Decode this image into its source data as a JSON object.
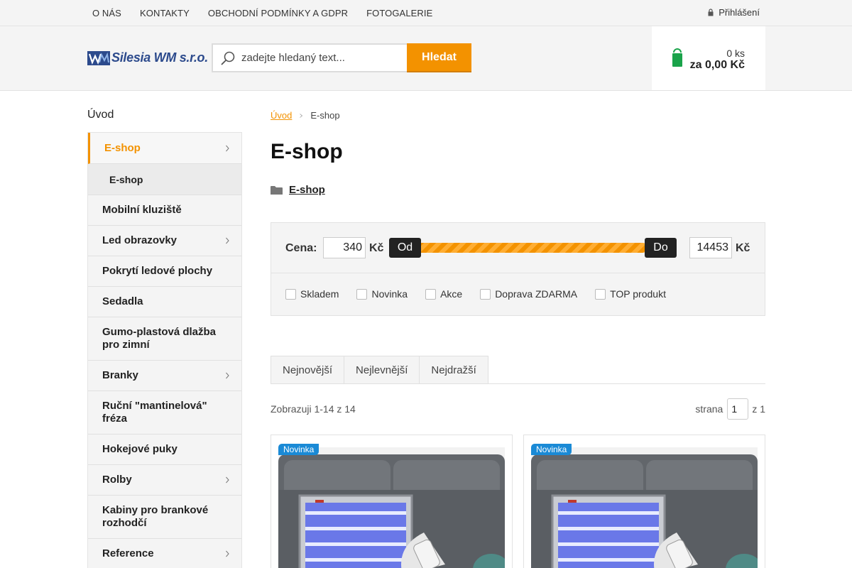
{
  "topnav": {
    "links": [
      "O NÁS",
      "KONTAKTY",
      "OBCHODNÍ PODMÍNKY A GDPR",
      "FOTOGALERIE"
    ],
    "login": "Přihlášení"
  },
  "header": {
    "logo_text": "Silesia WM s.r.o.",
    "search_placeholder": "zadejte hledaný text...",
    "search_button": "Hledat",
    "cart_qty": "0 ks",
    "cart_price": "za 0,00 Kč"
  },
  "sidebar": {
    "title": "Úvod",
    "items": [
      {
        "label": "E-shop",
        "active": true,
        "chevron": true
      },
      {
        "label": "E-shop",
        "sub": true
      },
      {
        "label": "Mobilní kluziště"
      },
      {
        "label": "Led obrazovky",
        "chevron": true
      },
      {
        "label": "Pokrytí ledové plochy"
      },
      {
        "label": "Sedadla"
      },
      {
        "label": "Gumo-plastová dlažba pro zimní"
      },
      {
        "label": "Branky",
        "chevron": true
      },
      {
        "label": "Ruční \"mantinelová\" fréza"
      },
      {
        "label": "Hokejové puky"
      },
      {
        "label": "Rolby",
        "chevron": true
      },
      {
        "label": "Kabiny pro brankové rozhodčí"
      },
      {
        "label": "Reference",
        "chevron": true
      }
    ]
  },
  "breadcrumb": {
    "home": "Úvod",
    "current": "E-shop"
  },
  "page": {
    "title": "E-shop",
    "category_link": "E-shop"
  },
  "filter": {
    "price_label": "Cena:",
    "price_from": "340",
    "price_to": "14453",
    "currency": "Kč",
    "handle_from": "Od",
    "handle_to": "Do",
    "checkboxes": [
      "Skladem",
      "Novinka",
      "Akce",
      "Doprava ZDARMA",
      "TOP produkt"
    ]
  },
  "sorting": {
    "tabs": [
      "Nejnovější",
      "Nejlevnější",
      "Nejdražší"
    ]
  },
  "listing": {
    "showing": "Zobrazuji 1-14 z 14",
    "page_label": "strana",
    "page_value": "1",
    "page_total": "z 1"
  },
  "products": [
    {
      "badge": "Novinka"
    },
    {
      "badge": "Novinka"
    }
  ],
  "colors": {
    "accent": "#f39200",
    "badge": "#1a8ad6",
    "cart_icon": "#1aa34a"
  }
}
